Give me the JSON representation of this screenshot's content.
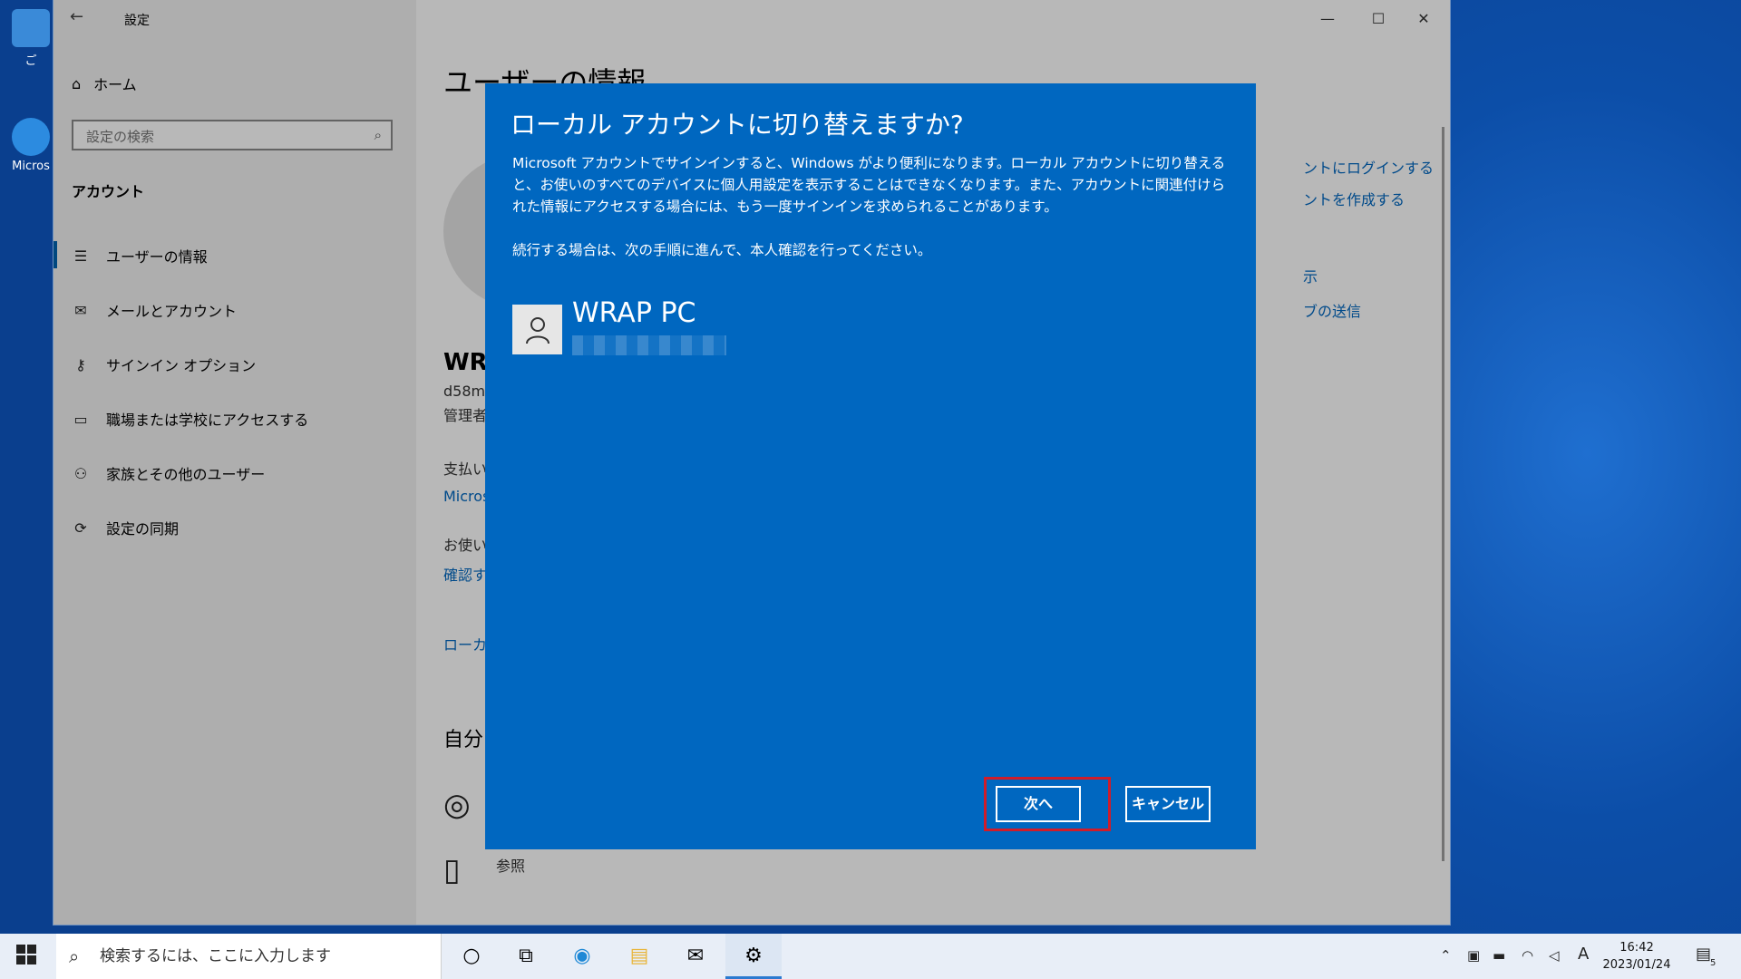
{
  "window": {
    "title": "設定",
    "back_glyph": "←",
    "minimize_glyph": "—",
    "maximize_glyph": "☐",
    "close_glyph": "✕"
  },
  "sidebar": {
    "home_label": "ホーム",
    "search_placeholder": "設定の検索",
    "section_label": "アカウント",
    "items": [
      {
        "label": "ユーザーの情報",
        "icon": "user-info-icon",
        "glyph": "☰"
      },
      {
        "label": "メールとアカウント",
        "icon": "mail-icon",
        "glyph": "✉"
      },
      {
        "label": "サインイン オプション",
        "icon": "key-icon",
        "glyph": "⚷"
      },
      {
        "label": "職場または学校にアクセスする",
        "icon": "briefcase-icon",
        "glyph": "▭"
      },
      {
        "label": "家族とその他のユーザー",
        "icon": "person-add-icon",
        "glyph": "⚇"
      },
      {
        "label": "設定の同期",
        "icon": "sync-icon",
        "glyph": "⟳"
      }
    ]
  },
  "content": {
    "heading": "ユーザーの情報",
    "user_name_partial": "WR",
    "user_id_partial": "d58m",
    "role_partial": "管理者",
    "payment_partial": "支払い",
    "micro_link_partial": "Micros",
    "usage_partial": "お使い",
    "confirm_link_partial": "確認す",
    "local_link_partial": "ローカル",
    "self_partial": "自分",
    "browse_label": "参照",
    "right_links": [
      "ントにログインする",
      "ントを作成する",
      "示",
      "ブの送信"
    ]
  },
  "dialog": {
    "title": "ローカル アカウントに切り替えますか?",
    "body_1": "Microsoft アカウントでサインインすると、Windows がより便利になります。ローカル アカウントに切り替えると、お使いのすべてのデバイスに個人用設定を表示することはできなくなります。また、アカウントに関連付けられた情報にアクセスする場合には、もう一度サインインを求められることがあります。",
    "body_2": "続行する場合は、次の手順に進んで、本人確認を行ってください。",
    "account_name": "WRAP PC",
    "next_button": "次へ",
    "cancel_button": "キャンセル"
  },
  "taskbar": {
    "search_placeholder": "検索するには、ここに入力します",
    "time": "16:42",
    "date": "2023/01/24",
    "ime_indicator": "A",
    "notification_count": "5"
  },
  "desktop": {
    "icon_labels": [
      "ご",
      "Micros"
    ]
  }
}
